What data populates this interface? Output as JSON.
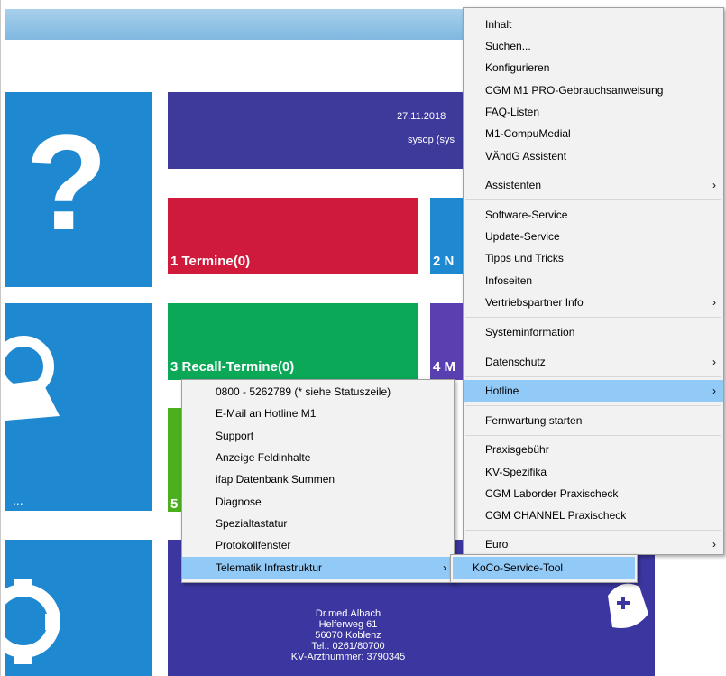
{
  "colors": {
    "header": "#3e3a9c",
    "tile_blue": "#1e88d0",
    "tile_red": "#cf1a3c",
    "tile_green": "#0aa857",
    "tile_lime": "#4cb01e",
    "tile_purple": "#5a3fb0",
    "tile_navy": "#3c37a0",
    "highlight": "#91c9f7"
  },
  "header": {
    "date": "27.11.2018",
    "user": "sysop (sys"
  },
  "tiles": {
    "termine": "1 Termine(0)",
    "second": "2 N",
    "recall": "3 Recall-Termine(0)",
    "fourth": "4 M",
    "fifth": "5",
    "help_glyph": "?"
  },
  "doctor": {
    "name": "Dr.med.Albach",
    "street": "Helferweg 61",
    "city": "56070 Koblenz",
    "phone": "Tel.: 0261/80700",
    "kv": "KV-Arztnummer: 3790345"
  },
  "main_menu": {
    "items": [
      "Inhalt",
      "Suchen...",
      "Konfigurieren",
      "CGM M1 PRO-Gebrauchsanweisung",
      "FAQ-Listen",
      "M1-CompuMedial",
      "VÄndG Assistent",
      "Assistenten",
      "Software-Service",
      "Update-Service",
      "Tipps und Tricks",
      "Infoseiten",
      "Vertriebspartner Info",
      "Systeminformation",
      "Datenschutz",
      "Hotline",
      "Fernwartung starten",
      "Praxisgebühr",
      "KV-Spezifika",
      "CGM Laborder Praxischeck",
      "CGM CHANNEL Praxischeck",
      "Euro"
    ],
    "arrow": "›"
  },
  "hotline_menu": {
    "items": [
      "0800 - 5262789 (* siehe Statuszeile)",
      "E-Mail an Hotline M1",
      "Support",
      "Anzeige Feldinhalte",
      "ifap Datenbank Summen",
      "Diagnose",
      "Spezialtastatur",
      "Protokollfenster",
      "Telematik Infrastruktur"
    ],
    "arrow": "›"
  },
  "ti_menu": {
    "items": [
      "KoCo-Service-Tool"
    ]
  }
}
